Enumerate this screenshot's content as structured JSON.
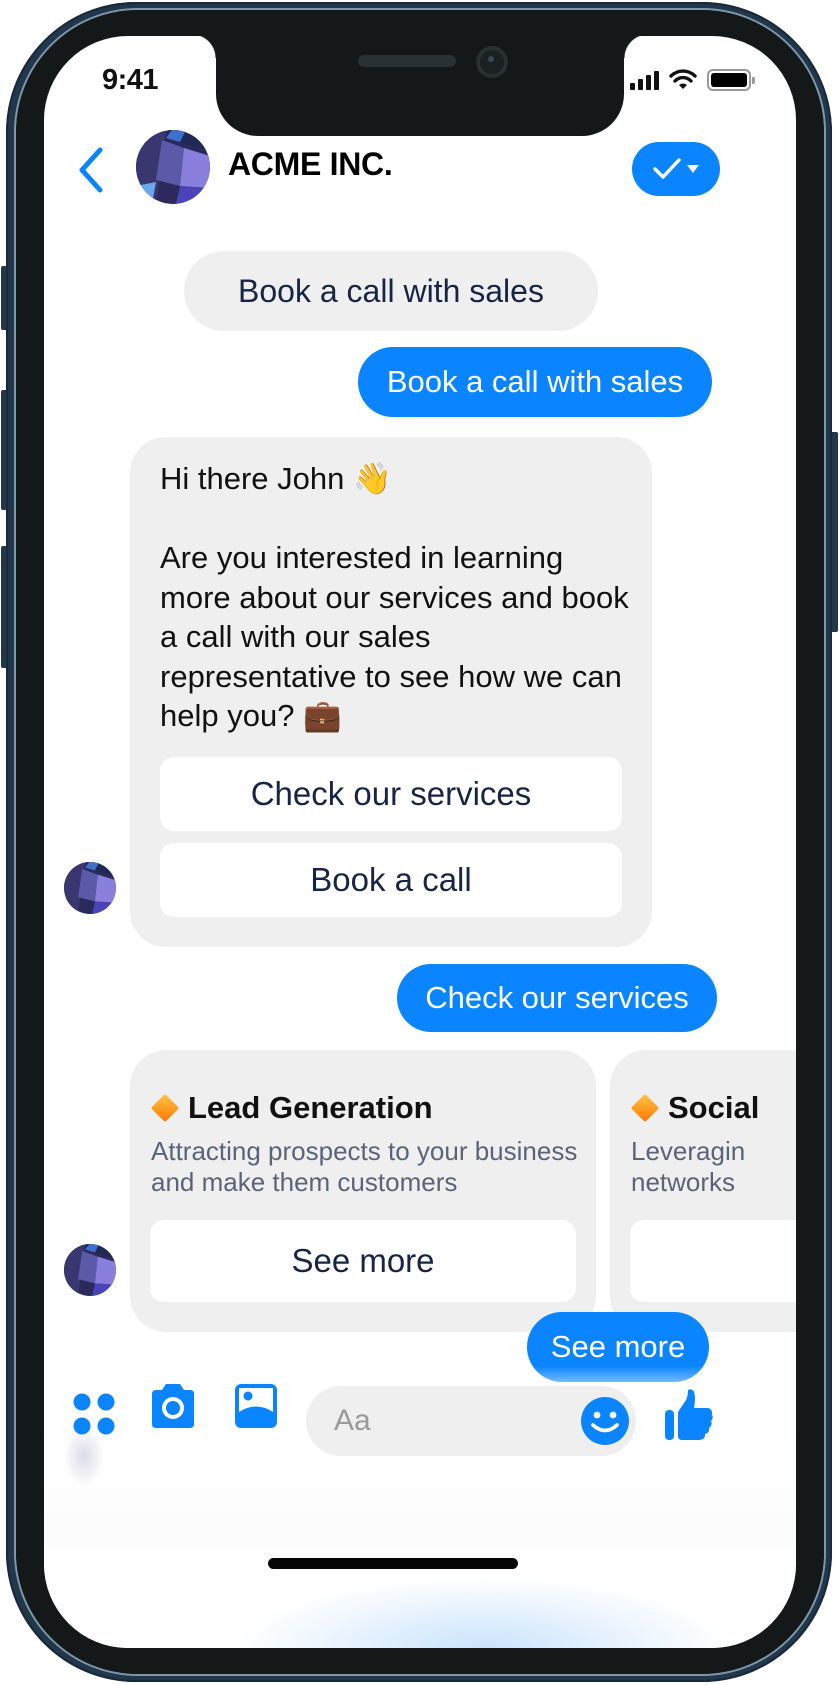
{
  "device": {
    "status_bar": {
      "time": "9:41",
      "icons": [
        "cellular-signal-icon",
        "wifi-icon",
        "battery-icon"
      ]
    }
  },
  "header": {
    "back_icon": "chevron-left-icon",
    "contact_name": "ACME INC.",
    "action_icons": [
      "checkmark-icon",
      "caret-down-icon"
    ]
  },
  "colors": {
    "accent": "#0a84ff",
    "bubble_gray": "#efefef",
    "text_dark": "#172443",
    "subtext": "#5a6478"
  },
  "messages": [
    {
      "id": "bot-quick-reply-echo",
      "from": "bot",
      "text": "Book a call with sales"
    },
    {
      "id": "user-1",
      "from": "user",
      "text": "Book a call with sales"
    },
    {
      "id": "bot-card-1",
      "from": "bot",
      "text": "Hi there John 👋\n\nAre you interested in learning more about our services and book a call with our sales representative to see how we can help you? 💼",
      "buttons": [
        "Check our services",
        "Book a call"
      ]
    },
    {
      "id": "user-2",
      "from": "user",
      "text": "Check our services"
    },
    {
      "id": "bot-carousel",
      "from": "bot",
      "cards": [
        {
          "title": "Lead Generation",
          "icon": "orange-diamond-icon",
          "subtitle": "Attracting prospects to your business\nand make them customers",
          "button": "See more"
        },
        {
          "title": "Social",
          "icon": "orange-diamond-icon",
          "subtitle": "Leveragin\nnetworks",
          "button": ""
        }
      ]
    },
    {
      "id": "user-3",
      "from": "user",
      "text": "See more"
    }
  ],
  "composer": {
    "placeholder": "Aa",
    "icons": [
      "apps-icon",
      "camera-icon",
      "photo-icon",
      "emoji-icon",
      "thumbs-up-icon"
    ]
  }
}
